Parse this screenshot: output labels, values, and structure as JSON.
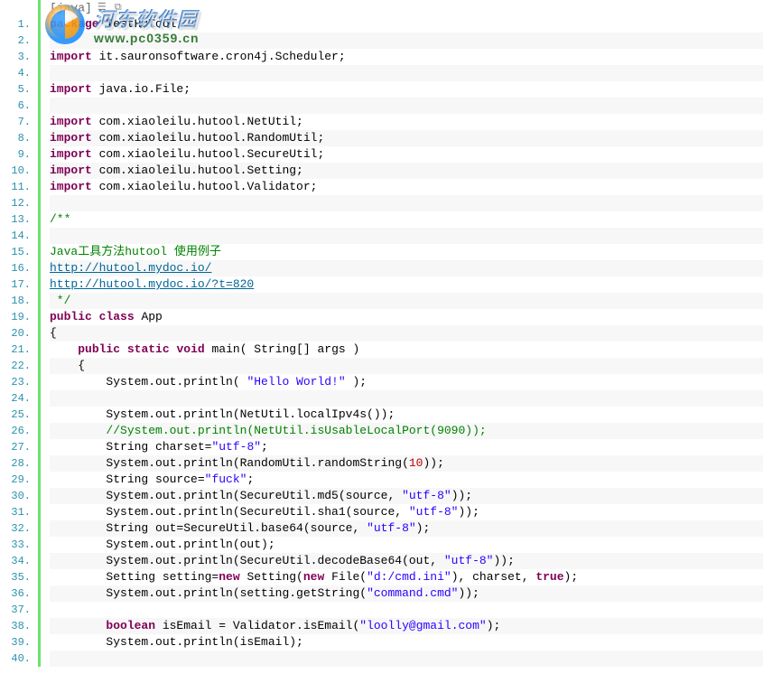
{
  "watermark": {
    "title": "河东软件园",
    "url": "www.pc0359.cn"
  },
  "toolbar": {
    "language_tag": "[java]",
    "icon1": "view-plain-icon",
    "icon2": "copy-icon"
  },
  "lines": [
    {
      "n": "1.",
      "segs": [
        {
          "t": "package",
          "c": "kw"
        },
        {
          "t": " TestHuTool;"
        }
      ]
    },
    {
      "n": "2.",
      "segs": []
    },
    {
      "n": "3.",
      "segs": [
        {
          "t": "import",
          "c": "kw"
        },
        {
          "t": " it.sauronsoftware.cron4j.Scheduler;"
        }
      ]
    },
    {
      "n": "4.",
      "segs": []
    },
    {
      "n": "5.",
      "segs": [
        {
          "t": "import",
          "c": "kw"
        },
        {
          "t": " java.io.File;"
        }
      ]
    },
    {
      "n": "6.",
      "segs": []
    },
    {
      "n": "7.",
      "segs": [
        {
          "t": "import",
          "c": "kw"
        },
        {
          "t": " com.xiaoleilu.hutool.NetUtil;"
        }
      ]
    },
    {
      "n": "8.",
      "segs": [
        {
          "t": "import",
          "c": "kw"
        },
        {
          "t": " com.xiaoleilu.hutool.RandomUtil;"
        }
      ]
    },
    {
      "n": "9.",
      "segs": [
        {
          "t": "import",
          "c": "kw"
        },
        {
          "t": " com.xiaoleilu.hutool.SecureUtil;"
        }
      ]
    },
    {
      "n": "10.",
      "segs": [
        {
          "t": "import",
          "c": "kw"
        },
        {
          "t": " com.xiaoleilu.hutool.Setting;"
        }
      ]
    },
    {
      "n": "11.",
      "segs": [
        {
          "t": "import",
          "c": "kw"
        },
        {
          "t": " com.xiaoleilu.hutool.Validator;"
        }
      ]
    },
    {
      "n": "12.",
      "segs": []
    },
    {
      "n": "13.",
      "segs": [
        {
          "t": "/**",
          "c": "docc"
        }
      ]
    },
    {
      "n": "14.",
      "segs": []
    },
    {
      "n": "15.",
      "segs": [
        {
          "t": "Java工具方法hutool 使用例子",
          "c": "docc"
        }
      ]
    },
    {
      "n": "16.",
      "segs": [
        {
          "t": "http://hutool.mydoc.io/",
          "c": "link"
        }
      ]
    },
    {
      "n": "17.",
      "segs": [
        {
          "t": "http://hutool.mydoc.io/?t=820",
          "c": "link"
        }
      ]
    },
    {
      "n": "18.",
      "segs": [
        {
          "t": " */",
          "c": "docc"
        }
      ]
    },
    {
      "n": "19.",
      "segs": [
        {
          "t": "public",
          "c": "kw"
        },
        {
          "t": " "
        },
        {
          "t": "class",
          "c": "kw-class"
        },
        {
          "t": " App"
        }
      ]
    },
    {
      "n": "20.",
      "segs": [
        {
          "t": "{"
        }
      ]
    },
    {
      "n": "21.",
      "segs": [
        {
          "t": "    "
        },
        {
          "t": "public",
          "c": "kw"
        },
        {
          "t": " "
        },
        {
          "t": "static",
          "c": "kw"
        },
        {
          "t": " "
        },
        {
          "t": "void",
          "c": "kw"
        },
        {
          "t": " main( String[] args )"
        }
      ]
    },
    {
      "n": "22.",
      "segs": [
        {
          "t": "    {"
        }
      ]
    },
    {
      "n": "23.",
      "segs": [
        {
          "t": "        System.out.println( "
        },
        {
          "t": "\"Hello World!\"",
          "c": "str"
        },
        {
          "t": " );"
        }
      ]
    },
    {
      "n": "24.",
      "segs": []
    },
    {
      "n": "25.",
      "segs": [
        {
          "t": "        System.out.println(NetUtil.localIpv4s());"
        }
      ]
    },
    {
      "n": "26.",
      "segs": [
        {
          "t": "        "
        },
        {
          "t": "//System.out.println(NetUtil.isUsableLocalPort(9090));",
          "c": "com"
        }
      ]
    },
    {
      "n": "27.",
      "segs": [
        {
          "t": "        String charset="
        },
        {
          "t": "\"utf-8\"",
          "c": "str"
        },
        {
          "t": ";"
        }
      ]
    },
    {
      "n": "28.",
      "segs": [
        {
          "t": "        System.out.println(RandomUtil.randomString("
        },
        {
          "t": "10",
          "c": "num"
        },
        {
          "t": "));"
        }
      ]
    },
    {
      "n": "29.",
      "segs": [
        {
          "t": "        String source="
        },
        {
          "t": "\"fuck\"",
          "c": "str"
        },
        {
          "t": ";"
        }
      ]
    },
    {
      "n": "30.",
      "segs": [
        {
          "t": "        System.out.println(SecureUtil.md5(source, "
        },
        {
          "t": "\"utf-8\"",
          "c": "str"
        },
        {
          "t": "));"
        }
      ]
    },
    {
      "n": "31.",
      "segs": [
        {
          "t": "        System.out.println(SecureUtil.sha1(source, "
        },
        {
          "t": "\"utf-8\"",
          "c": "str"
        },
        {
          "t": "));"
        }
      ]
    },
    {
      "n": "32.",
      "segs": [
        {
          "t": "        String out=SecureUtil.base64(source, "
        },
        {
          "t": "\"utf-8\"",
          "c": "str"
        },
        {
          "t": ");"
        }
      ]
    },
    {
      "n": "33.",
      "segs": [
        {
          "t": "        System.out.println(out);"
        }
      ]
    },
    {
      "n": "34.",
      "segs": [
        {
          "t": "        System.out.println(SecureUtil.decodeBase64(out, "
        },
        {
          "t": "\"utf-8\"",
          "c": "str"
        },
        {
          "t": "));"
        }
      ]
    },
    {
      "n": "35.",
      "segs": [
        {
          "t": "        Setting setting="
        },
        {
          "t": "new",
          "c": "kw"
        },
        {
          "t": " Setting("
        },
        {
          "t": "new",
          "c": "kw"
        },
        {
          "t": " File("
        },
        {
          "t": "\"d:/cmd.ini\"",
          "c": "str"
        },
        {
          "t": "), charset, "
        },
        {
          "t": "true",
          "c": "bool"
        },
        {
          "t": ");"
        }
      ]
    },
    {
      "n": "36.",
      "segs": [
        {
          "t": "        System.out.println(setting.getString("
        },
        {
          "t": "\"command.cmd\"",
          "c": "str"
        },
        {
          "t": "));"
        }
      ]
    },
    {
      "n": "37.",
      "segs": []
    },
    {
      "n": "38.",
      "segs": [
        {
          "t": "        "
        },
        {
          "t": "boolean",
          "c": "kw"
        },
        {
          "t": " isEmail = Validator.isEmail("
        },
        {
          "t": "\"loolly@gmail.com\"",
          "c": "str"
        },
        {
          "t": ");"
        }
      ]
    },
    {
      "n": "39.",
      "segs": [
        {
          "t": "        System.out.println(isEmail);"
        }
      ]
    },
    {
      "n": "40.",
      "segs": []
    }
  ]
}
